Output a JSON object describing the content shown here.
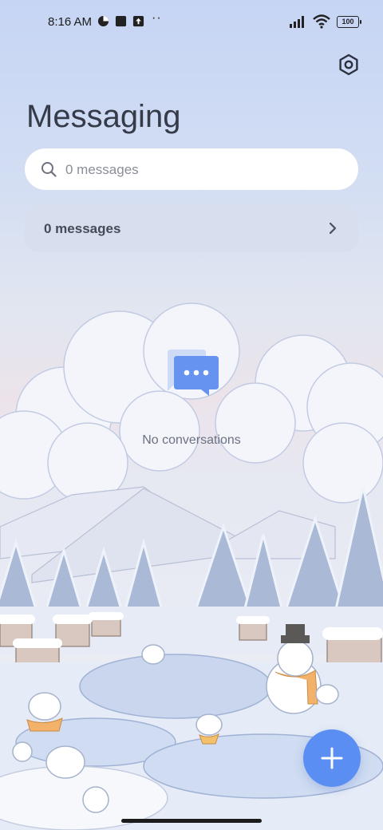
{
  "status": {
    "time": "8:16 AM",
    "battery": "100",
    "extra": "··"
  },
  "header": {
    "title": "Messaging"
  },
  "search": {
    "placeholder": "0 messages"
  },
  "summary": {
    "label": "0 messages"
  },
  "empty_state": {
    "text": "No conversations"
  },
  "icons": {
    "settings": "settings-icon",
    "search": "search-icon",
    "chevron": "chevron-right-icon",
    "empty": "chat-bubble-icon",
    "fab": "plus-icon"
  },
  "colors": {
    "accent": "#5b8ef2",
    "title": "#363b4a"
  }
}
